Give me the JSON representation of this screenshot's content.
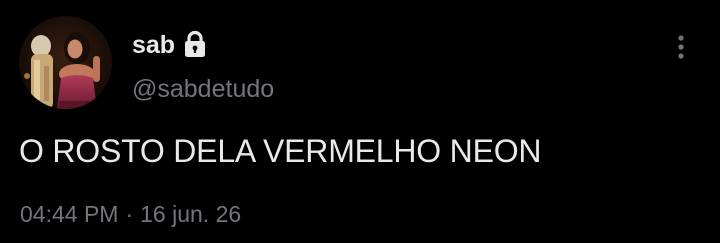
{
  "author": {
    "display_name": "sab",
    "handle": "@sabdetudo",
    "protected_icon": "lock-icon",
    "avatar": "profile-photo"
  },
  "post": {
    "text": "O ROSTO DELA VERMELHO NEON",
    "time": "04:44 PM",
    "separator": "·",
    "date": "16 jun. 26"
  },
  "actions": {
    "more_icon": "more-vertical-icon"
  },
  "colors": {
    "background": "#000000",
    "primary_text": "#e7e9ea",
    "secondary_text": "#71767b"
  }
}
